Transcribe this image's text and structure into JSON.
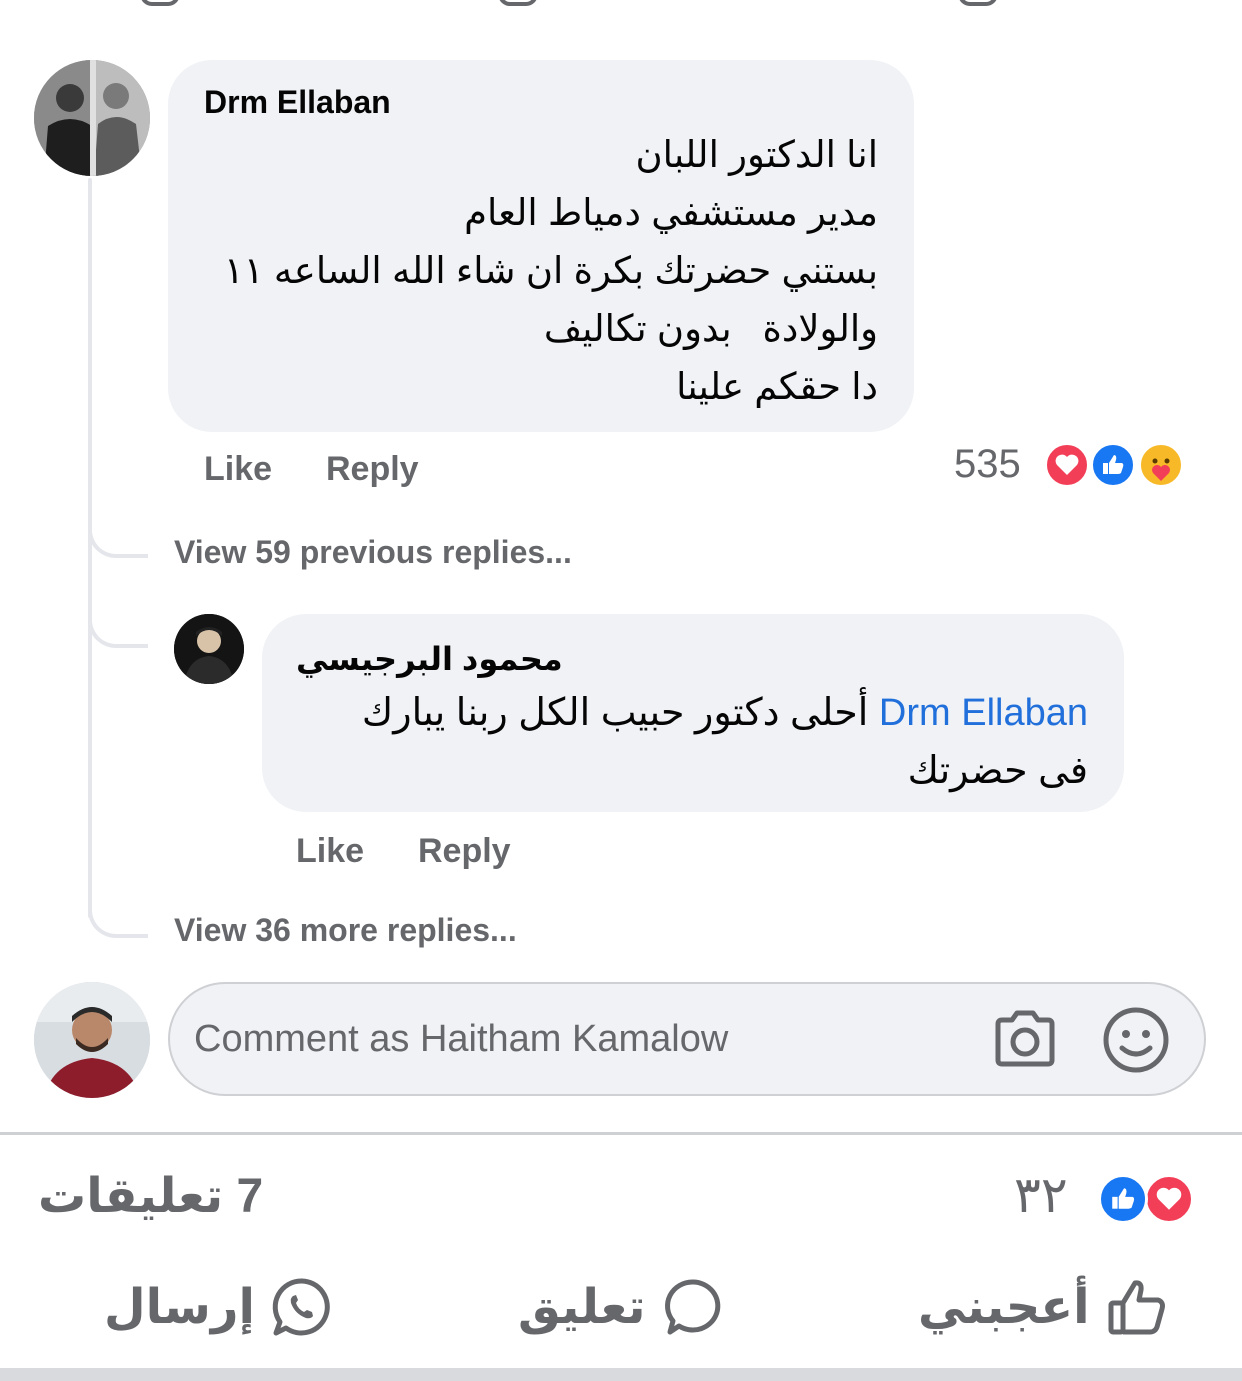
{
  "comment": {
    "author": "Drm Ellaban",
    "lines": [
      "انا الدكتور اللبان",
      "مدير مستشفي دمياط العام",
      "بستني حضرتك بكرة ان شاء الله الساعه ١١",
      "والولادة   بدون تكاليف",
      "دا حقكم علينا"
    ],
    "like_label": "Like",
    "reply_label": "Reply",
    "reaction_count": "535",
    "reactions": [
      "heart-icon",
      "like-icon",
      "care-icon"
    ]
  },
  "view_previous": "View 59 previous replies...",
  "reply": {
    "author": "محمود البرجيسي",
    "mention": "Drm Ellaban",
    "text_line1": " أحلى دكتور حبيب الكل ربنا يبارك",
    "text_line2": "فى حضرتك",
    "like_label": "Like",
    "reply_label": "Reply"
  },
  "view_more": "View 36 more replies...",
  "composer": {
    "placeholder": "Comment as Haitham Kamalow",
    "icons": [
      "camera-icon",
      "smiley-icon"
    ]
  },
  "post_footer": {
    "comments_count": "7 تعليقات",
    "reactions_count": "٣٢",
    "reactions": [
      "like-icon",
      "heart-icon"
    ],
    "actions": {
      "like": "أعجبني",
      "comment": "تعليق",
      "send": "إرسال"
    }
  },
  "colors": {
    "bubble": "#f0f2f5",
    "mention": "#216fdb",
    "secondary_text": "#65676b",
    "like_blue": "#1877f2",
    "heart_red": "#f33e58"
  }
}
